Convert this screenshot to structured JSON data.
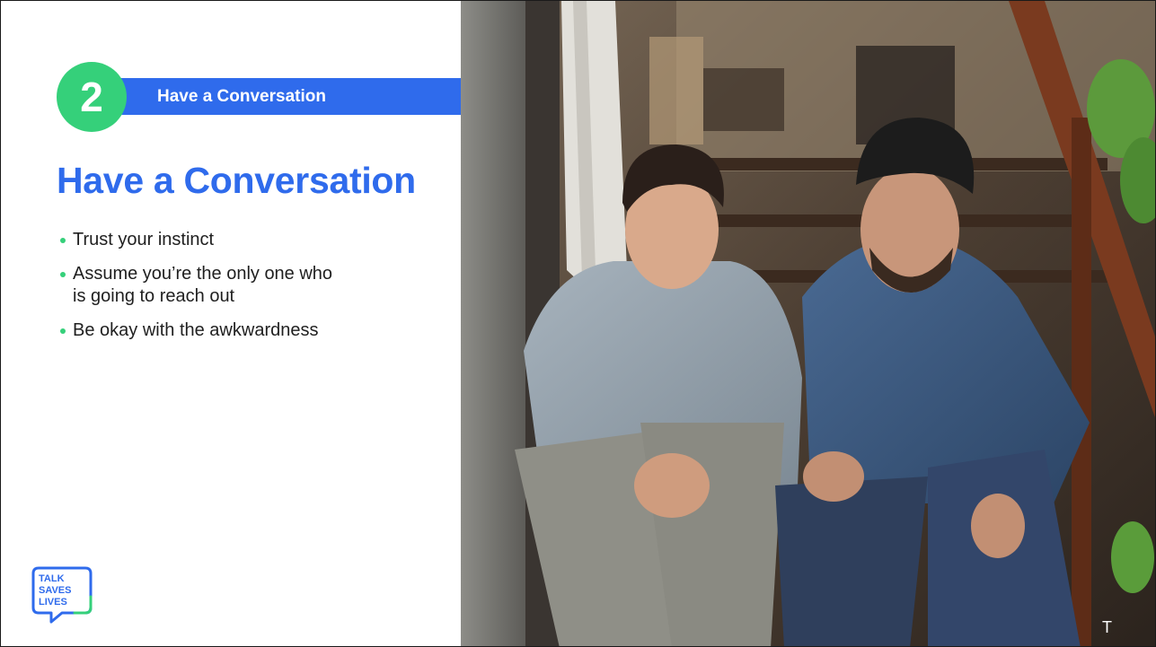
{
  "section": {
    "number": "2",
    "label": "Have a Conversation"
  },
  "title": "Have a Conversation",
  "bullets": [
    "Trust your instinct",
    "Assume you’re the only one who is going to reach out",
    "Be okay with the awkwardness"
  ],
  "logo": {
    "text": "TALK SAVES LIVES",
    "icon": "speech-bubble-logo-icon"
  },
  "photo": {
    "caption": "T"
  },
  "colors": {
    "accent_blue": "#2f6bec",
    "accent_green": "#35d07a",
    "text": "#1f1f1f"
  }
}
